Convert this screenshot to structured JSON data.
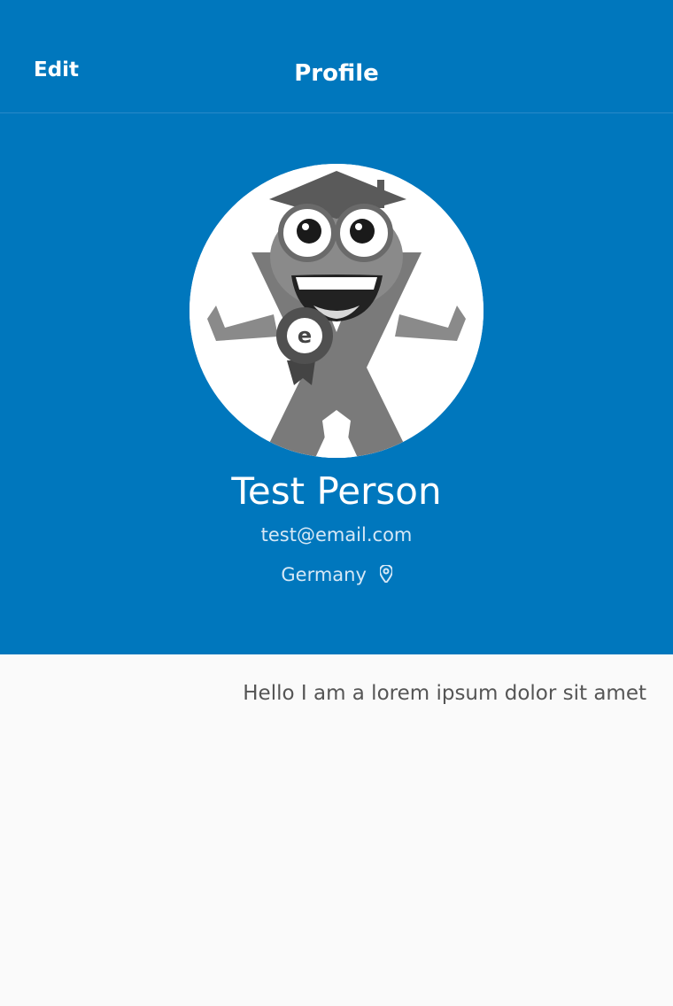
{
  "navbar": {
    "edit_label": "Edit",
    "title": "Profile"
  },
  "profile": {
    "avatar_icon": "mascot-avatar-icon",
    "name": "Test Person",
    "email": "test@email.com",
    "location": "Germany",
    "location_icon": "map-pin-icon",
    "bio": "Hello I am a lorem ipsum dolor sit amet"
  },
  "colors": {
    "primary": "#0077bd",
    "background": "#fafafa",
    "text_muted": "#555555"
  }
}
